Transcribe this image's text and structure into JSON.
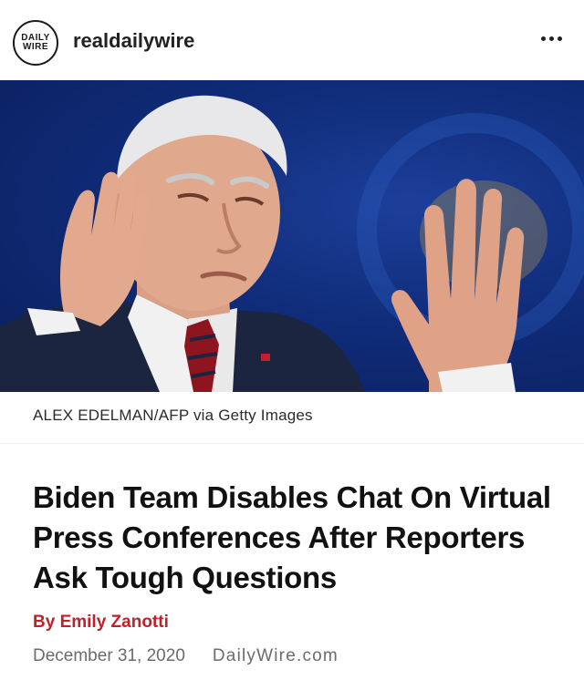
{
  "post": {
    "username": "realdailywire",
    "avatar_text_top": "DAILY",
    "avatar_text_bottom": "WIRE",
    "more_icon": "more-horizontal-icon"
  },
  "article": {
    "photo_credit": "ALEX EDELMAN/AFP via Getty Images",
    "headline": "Biden Team Disables Chat On Virtual Press Conferences After Reporters Ask Tough Questions",
    "byline": "By Emily Zanotti",
    "date": "December 31, 2020",
    "site": "DailyWire.com"
  },
  "colors": {
    "byline_red": "#c0202a",
    "photo_background_blue": "#102c7a",
    "meta_gray": "#6b6b6b"
  }
}
